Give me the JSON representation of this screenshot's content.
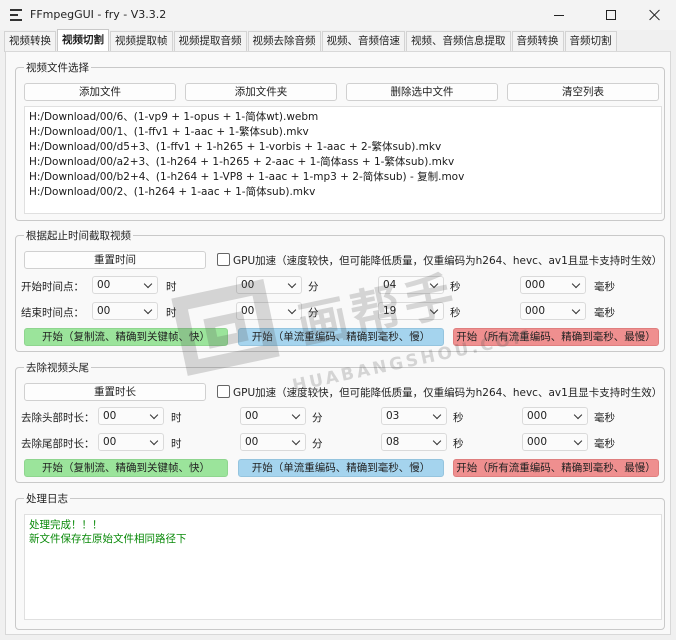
{
  "window": {
    "title": "FFmpegGUI - fry - V3.3.2"
  },
  "tabs": [
    "视频转换",
    "视频切割",
    "视频提取帧",
    "视频提取音频",
    "视频去除音频",
    "视频、音频倍速",
    "视频、音频信息提取",
    "音频转换",
    "音频切割"
  ],
  "file_group": {
    "legend": "视频文件选择",
    "buttons": [
      "添加文件",
      "添加文件夹",
      "删除选中文件",
      "清空列表"
    ],
    "files": [
      "H:/Download/00/6、(1-vp9 + 1-opus + 1-简体wt).webm",
      "H:/Download/00/1、(1-ffv1 + 1-aac + 1-繁体sub).mkv",
      "H:/Download/00/d5+3、(1-ffv1 + 1-h265 + 1-vorbis  + 1-aac + 2-繁体sub).mkv",
      "H:/Download/00/a2+3、(1-h264 + 1-h265 + 2-aac + 1-简体ass + 1-繁体sub).mkv",
      "H:/Download/00/b2+4、(1-h264 + 1-VP8 + 1-aac  + 1-mp3 + 2-简体sub) - 复制.mov",
      "H:/Download/00/2、(1-h264 + 1-aac + 1-简体sub).mkv"
    ]
  },
  "cut_group": {
    "legend": "根据起止时间截取视频",
    "reset_label": "重置时间",
    "gpu_label": "GPU加速（速度较快，但可能降低质量，仅重编码为h264、hevc、av1且显卡支持时生效）",
    "start_label": "开始时间点：",
    "end_label": "结束时间点：",
    "units": [
      "时",
      "分",
      "秒",
      "毫秒"
    ],
    "start_values": [
      "00",
      "00",
      "04",
      "000"
    ],
    "end_values": [
      "00",
      "00",
      "19",
      "000"
    ],
    "actions": [
      "开始（复制流、精确到关键帧、快）",
      "开始（单流重编码、精确到毫秒、慢）",
      "开始（所有流重编码、精确到毫秒、最慢）"
    ]
  },
  "trim_group": {
    "legend": "去除视频头尾",
    "reset_label": "重置时长",
    "gpu_label": "GPU加速（速度较快，但可能降低质量，仅重编码为h264、hevc、av1且显卡支持时生效）",
    "head_label": "去除头部时长：",
    "tail_label": "去除尾部时长：",
    "units": [
      "时",
      "分",
      "秒",
      "毫秒"
    ],
    "head_values": [
      "00",
      "00",
      "03",
      "000"
    ],
    "tail_values": [
      "00",
      "00",
      "08",
      "000"
    ],
    "actions": [
      "开始（复制流、精确到关键帧、快）",
      "开始（单流重编码、精确到毫秒、慢）",
      "开始（所有流重编码、精确到毫秒、最慢）"
    ]
  },
  "log_group": {
    "legend": "处理日志",
    "lines": [
      "处理完成！！！",
      "新文件保存在原始文件相同路径下"
    ]
  },
  "watermark": {
    "main": "画帮手",
    "sub": "HUABANGSHOU.COM"
  },
  "colors": {
    "green": "#9be49b",
    "blue": "#a5d4ee",
    "red": "#ef8f8f",
    "log_text": "#0a8a0a"
  }
}
